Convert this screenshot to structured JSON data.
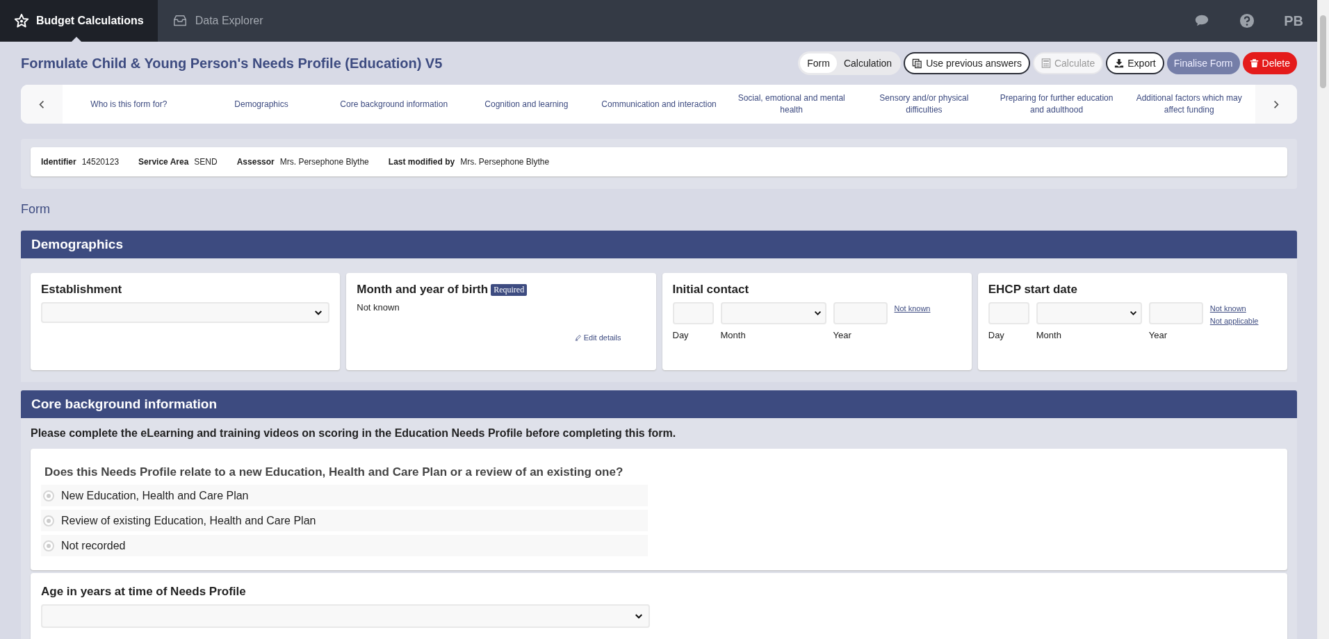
{
  "top_tabs": [
    {
      "label": "Budget Calculations",
      "selected": true
    },
    {
      "label": "Data Explorer",
      "selected": false
    }
  ],
  "user_initials": "PB",
  "page_title": "Formulate Child & Young Person's Needs Profile (Education) V5",
  "view_toggle": [
    {
      "label": "Form",
      "selected": true
    },
    {
      "label": "Calculation",
      "selected": false
    }
  ],
  "actions": [
    {
      "label": "Use previous answers",
      "kind": "outline",
      "disabled": false
    },
    {
      "label": "Calculate",
      "kind": "outline",
      "disabled": true
    },
    {
      "label": "Export",
      "kind": "outline",
      "disabled": false
    },
    {
      "label": "Finalise Form",
      "kind": "muted",
      "disabled": false
    },
    {
      "label": "Delete",
      "kind": "danger",
      "disabled": false
    }
  ],
  "section_nav": [
    "Who is this form for?",
    "Demographics",
    "Core background information",
    "Cognition and learning",
    "Communication and interaction",
    "Social, emotional and mental health",
    "Sensory and/or physical difficulties",
    "Preparing for further education and adulthood",
    "Additional factors which may affect funding"
  ],
  "info": [
    {
      "label": "Identifier",
      "value": "14520123"
    },
    {
      "label": "Service Area",
      "value": "SEND"
    },
    {
      "label": "Assessor",
      "value": "Mrs. Persephone Blythe"
    },
    {
      "label": "Last modified by",
      "value": "Mrs. Persephone Blythe"
    }
  ],
  "form_heading": "Form",
  "demographics": {
    "title": "Demographics",
    "cards": [
      {
        "kind": "select",
        "title": "Establishment"
      },
      {
        "kind": "text",
        "title": "Month and year of birth",
        "badge": "Required",
        "value": "Not known",
        "link": "Edit details"
      },
      {
        "kind": "date",
        "title": "Initial contact",
        "labels": [
          "Day",
          "Month",
          "Year"
        ],
        "links": [
          "Not known"
        ]
      },
      {
        "kind": "date",
        "title": "EHCP start date",
        "labels": [
          "Day",
          "Month",
          "Year"
        ],
        "links": [
          "Not known",
          "Not applicable"
        ]
      }
    ]
  },
  "core": {
    "title": "Core background information",
    "intro": "Please complete the eLearning and training videos on scoring in the Education Needs Profile before completing this form.",
    "question": "Does this Needs Profile relate to a new Education, Health and Care Plan or a review of an existing one?",
    "options": [
      {
        "label": "New Education, Health and Care Plan",
        "selected": false
      },
      {
        "label": "Review of existing Education, Health and Care Plan",
        "selected": false
      },
      {
        "label": "Not recorded",
        "selected": false
      }
    ],
    "age_label": "Age in years at time of Needs Profile"
  }
}
